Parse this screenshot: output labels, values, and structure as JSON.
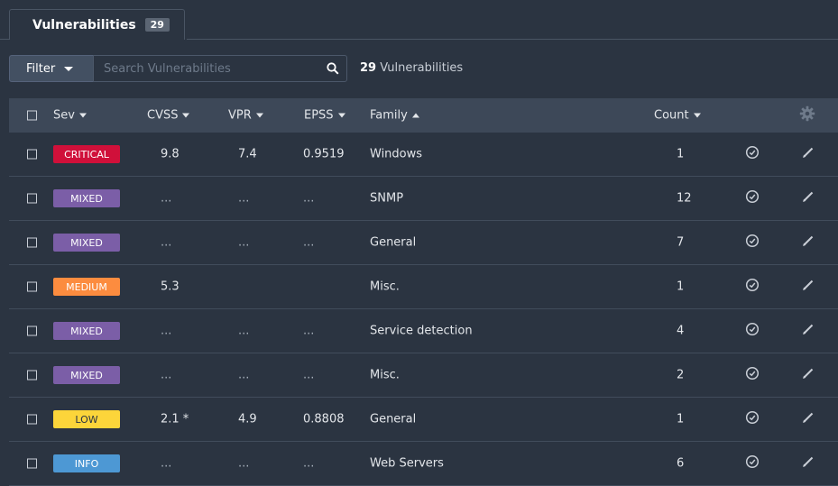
{
  "tab": {
    "label": "Vulnerabilities",
    "count": "29"
  },
  "toolbar": {
    "filter_label": "Filter",
    "search_placeholder": "Search Vulnerabilities",
    "result_count": "29",
    "result_suffix": " Vulnerabilities"
  },
  "table": {
    "headers": {
      "sev": "Sev",
      "cvss": "CVSS",
      "vpr": "VPR",
      "epss": "EPSS",
      "family": "Family",
      "count": "Count"
    },
    "rows": [
      {
        "sev": "CRITICAL",
        "sev_color": "#d0103a",
        "cvss": "9.8",
        "vpr": "7.4",
        "epss": "0.9519",
        "family": "Windows",
        "count": "1"
      },
      {
        "sev": "MIXED",
        "sev_color": "#7b5ea7",
        "cvss": "...",
        "vpr": "...",
        "epss": "...",
        "family": "SNMP",
        "count": "12"
      },
      {
        "sev": "MIXED",
        "sev_color": "#7b5ea7",
        "cvss": "...",
        "vpr": "...",
        "epss": "...",
        "family": "General",
        "count": "7"
      },
      {
        "sev": "MEDIUM",
        "sev_color": "#fc8c3f",
        "cvss": "5.3",
        "vpr": "",
        "epss": "",
        "family": "Misc.",
        "count": "1"
      },
      {
        "sev": "MIXED",
        "sev_color": "#7b5ea7",
        "cvss": "...",
        "vpr": "...",
        "epss": "...",
        "family": "Service detection",
        "count": "4"
      },
      {
        "sev": "MIXED",
        "sev_color": "#7b5ea7",
        "cvss": "...",
        "vpr": "...",
        "epss": "...",
        "family": "Misc.",
        "count": "2"
      },
      {
        "sev": "LOW",
        "sev_color": "#fcd53a",
        "cvss": "2.1 *",
        "vpr": "4.9",
        "epss": "0.8808",
        "family": "General",
        "count": "1"
      },
      {
        "sev": "INFO",
        "sev_color": "#4d98d4",
        "cvss": "...",
        "vpr": "...",
        "epss": "...",
        "family": "Web Servers",
        "count": "6"
      }
    ]
  },
  "icons": {
    "settings": "gear-icon",
    "search": "search-icon",
    "snooze": "clock-icon",
    "edit": "pencil-icon"
  }
}
